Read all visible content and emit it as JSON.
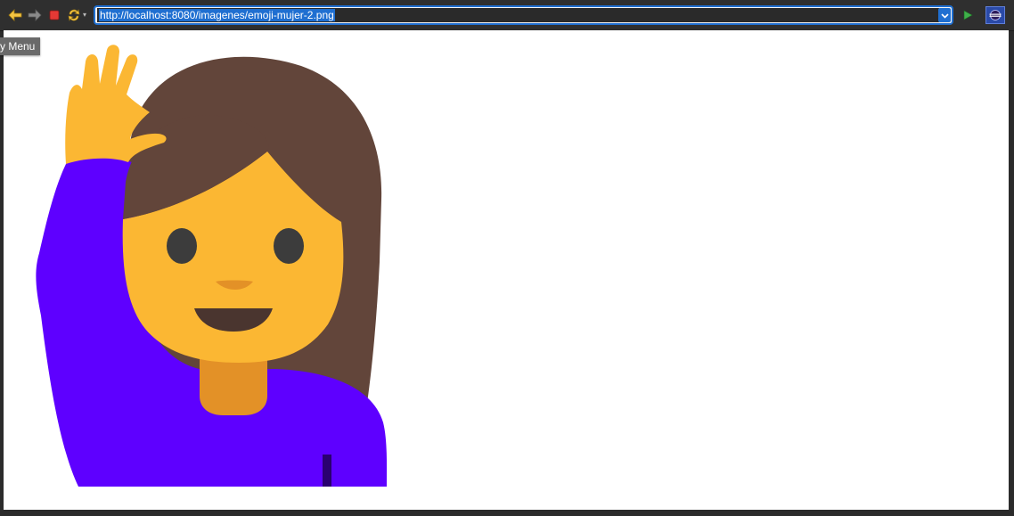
{
  "toolbar": {
    "back_icon": "back-arrow-icon",
    "forward_icon": "forward-arrow-icon",
    "stop_icon": "stop-icon",
    "refresh_icon": "refresh-icon",
    "go_icon": "go-play-icon",
    "eclipse_icon": "eclipse-browser-icon"
  },
  "address_bar": {
    "url": "http://localhost:8080/imagenes/emoji-mujer-2.png",
    "dropdown_icon": "chevron-down-icon"
  },
  "tooltip": {
    "text": "y Menu"
  },
  "page": {
    "image_alt": "emoji-mujer-2.png",
    "image_subject": "woman-raising-hand-emoji"
  },
  "colors": {
    "hair": "#62453a",
    "skin": "#fbb733",
    "neck": "#e39127",
    "shirt": "#5e00ff",
    "eyes": "#3c3c3c",
    "mouth": "#4a352f",
    "nose": "#e39127",
    "url_highlight": "#1f6fd1"
  }
}
